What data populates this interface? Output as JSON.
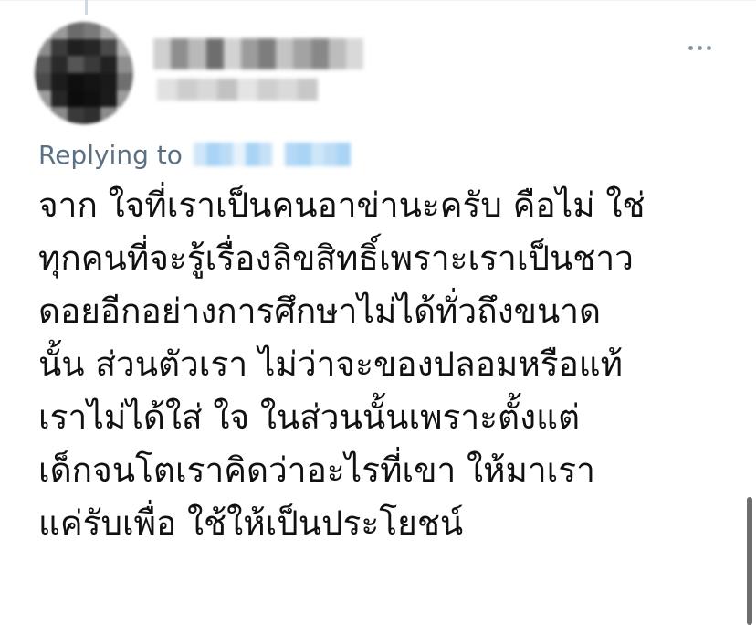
{
  "tweet": {
    "replying_label": "Replying to",
    "text_lines": [
      "จาก ใจที่เราเป็นคนอาข่านะครับ คือไม่ ใช่",
      "ทุกคนที่จะรู้เรื่องลิขสิทธิ์เพราะเราเป็นชาว",
      "ดอยอีกอย่างการศึกษาไม่ได้ทั่วถึงขนาด",
      "นั้น ส่วนตัวเรา ไม่ว่าจะของปลอมหรือแท้",
      "เราไม่ได้ใส่ ใจ ในส่วนนั้นเพราะตั้งแต่",
      "เด็กจนโตเราคิดว่าอะไรที่เขา ให้มาเรา",
      "แค่รับเพื่อ ใช้ให้เป็นประโยชน์"
    ]
  },
  "icons": {
    "more": "more-options-icon"
  },
  "colors": {
    "text": "#111111",
    "secondary": "#5b7083",
    "mention_blur": "#a9d4f5",
    "icon_gray": "#8b98a5"
  }
}
